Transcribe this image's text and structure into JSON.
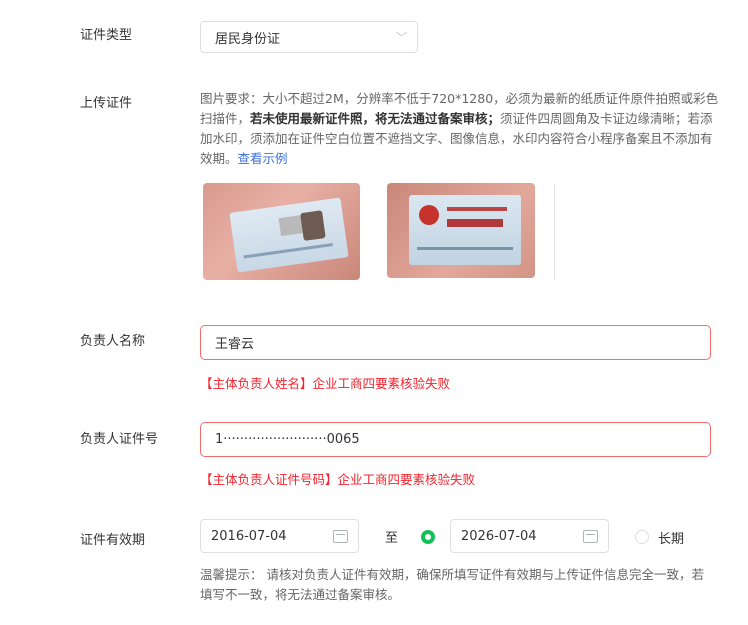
{
  "cert_type": {
    "label": "证件类型",
    "value": "居民身份证"
  },
  "upload": {
    "label": "上传证件",
    "req_part1": "图片要求：大小不超过2M，分辨率不低于720*1280，必须为最新的纸质证件原件拍照或彩色扫描件，",
    "req_bold": "若未使用最新证件照，将无法通过备案审核；",
    "req_part2": "须证件四周圆角及卡证边缘清晰；若添加水印，须添加在证件空白位置不遮挡文字、图像信息，水印内容符合小程序备案且不添加有效期。",
    "example_link": "查看示例"
  },
  "name": {
    "label": "负责人名称",
    "value": "王睿云",
    "error": "【主体负责人姓名】企业工商四要素核验失败"
  },
  "id_no": {
    "label": "负责人证件号",
    "value": "1·························0065",
    "error": "【主体负责人证件号码】企业工商四要素核验失败"
  },
  "validity": {
    "label": "证件有效期",
    "start": "2016-07-04",
    "to": "至",
    "end": "2026-07-04",
    "long_term": "长期",
    "tip": "温馨提示： 请核对负责人证件有效期，确保所填写证件有效期与上传证件信息完全一致，若填写不一致，将无法通过备案审核。"
  }
}
